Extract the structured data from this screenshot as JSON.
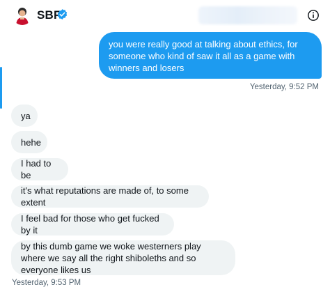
{
  "header": {
    "name": "SBF",
    "avatar_icon": "user-avatar",
    "verified_icon": "verified-badge-icon",
    "info_icon": "info-icon"
  },
  "messages": {
    "sent": {
      "text": "you were really good at talking about ethics, for someone who kind of saw it all as a game with winners and losers",
      "timestamp": "Yesterday, 9:52 PM"
    },
    "received": [
      {
        "text": "ya"
      },
      {
        "text": "hehe"
      },
      {
        "text": "I had to be"
      },
      {
        "text": "it's what reputations are made of, to some extent"
      },
      {
        "text": "I feel bad for those who get fucked by it"
      },
      {
        "text": "by this dumb game we woke westerners play where we say all the right shiboleths and so everyone likes us"
      }
    ],
    "received_timestamp": "Yesterday, 9:53 PM"
  },
  "colors": {
    "accent": "#1d9bf0",
    "bubble_received": "#eff3f4",
    "text_secondary": "#536471"
  }
}
